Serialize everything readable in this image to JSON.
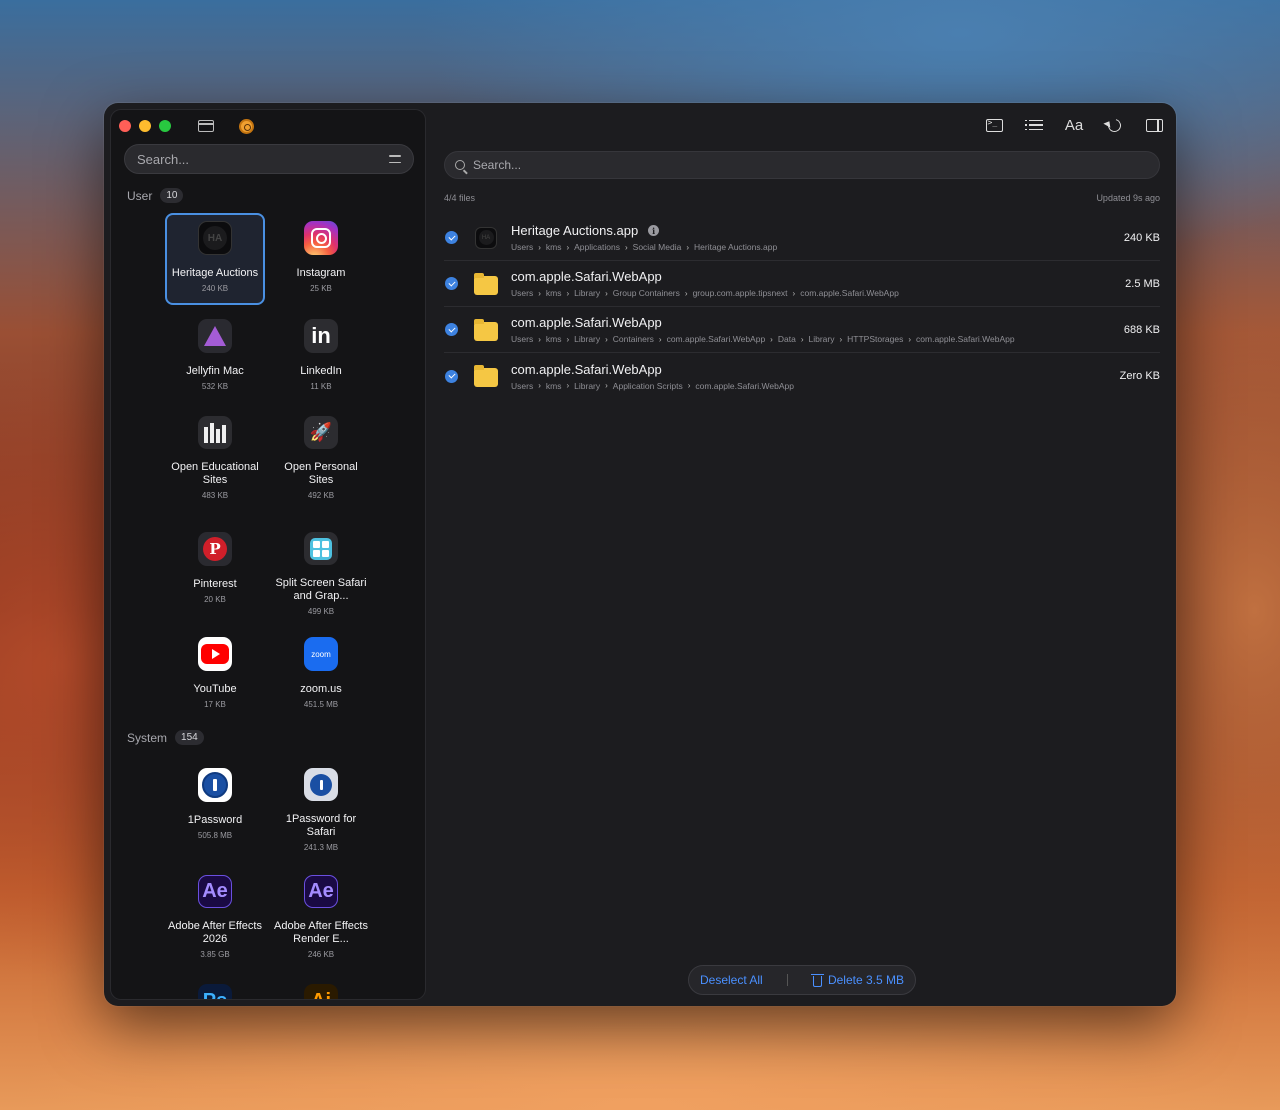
{
  "sidebar": {
    "search_placeholder": "Search...",
    "user_section": {
      "label": "User",
      "count": "10"
    },
    "system_section": {
      "label": "System",
      "count": "154"
    },
    "user_apps": [
      {
        "name": "Heritage Auctions",
        "size": "240 KB",
        "icon": "heritage-auctions-icon",
        "glyph": "HA",
        "selected": true
      },
      {
        "name": "Instagram",
        "size": "25 KB",
        "icon": "instagram-icon"
      },
      {
        "name": "Jellyfin Mac",
        "size": "532 KB",
        "icon": "jellyfin-icon"
      },
      {
        "name": "LinkedIn",
        "size": "11 KB",
        "icon": "linkedin-icon",
        "glyph": "in"
      },
      {
        "name": "Open Educational Sites",
        "size": "483 KB",
        "icon": "library-icon"
      },
      {
        "name": "Open Personal Sites",
        "size": "492 KB",
        "icon": "rocket-icon",
        "glyph": "🚀"
      },
      {
        "name": "Pinterest",
        "size": "20 KB",
        "icon": "pinterest-icon",
        "glyph": "P"
      },
      {
        "name": "Split Screen Safari and Grap...",
        "size": "499 KB",
        "icon": "split-screen-icon"
      },
      {
        "name": "YouTube",
        "size": "17 KB",
        "icon": "youtube-icon"
      },
      {
        "name": "zoom.us",
        "size": "451.5 MB",
        "icon": "zoom-icon",
        "glyph": "zoom"
      }
    ],
    "system_apps": [
      {
        "name": "1Password",
        "size": "505.8 MB",
        "icon": "1password-icon"
      },
      {
        "name": "1Password for Safari",
        "size": "241.3 MB",
        "icon": "1password-safari-icon"
      },
      {
        "name": "Adobe After Effects 2026",
        "size": "3.85 GB",
        "icon": "after-effects-icon",
        "glyph": "Ae"
      },
      {
        "name": "Adobe After Effects Render E...",
        "size": "246 KB",
        "icon": "after-effects-render-icon",
        "glyph": "Ae"
      },
      {
        "name": "",
        "size": "",
        "icon": "photoshop-icon",
        "glyph": "Ps"
      },
      {
        "name": "",
        "size": "",
        "icon": "illustrator-icon",
        "glyph": "Ai"
      }
    ]
  },
  "main": {
    "search_placeholder": "Search...",
    "file_count": "4/4 files",
    "updated": "Updated 9s ago",
    "files": [
      {
        "name": "Heritage Auctions.app",
        "type": "app",
        "glyph": "HA",
        "info": true,
        "size": "240 KB",
        "path": [
          "Users",
          "kms",
          "Applications",
          "Social Media",
          "Heritage Auctions.app"
        ]
      },
      {
        "name": "com.apple.Safari.WebApp",
        "type": "folder",
        "size": "2.5 MB",
        "path": [
          "Users",
          "kms",
          "Library",
          "Group Containers",
          "group.com.apple.tipsnext",
          "com.apple.Safari.WebApp"
        ]
      },
      {
        "name": "com.apple.Safari.WebApp",
        "type": "folder",
        "size": "688 KB",
        "path": [
          "Users",
          "kms",
          "Library",
          "Containers",
          "com.apple.Safari.WebApp",
          "Data",
          "Library",
          "HTTPStorages",
          "com.apple.Safari.WebApp"
        ]
      },
      {
        "name": "com.apple.Safari.WebApp",
        "type": "folder",
        "size": "Zero KB",
        "path": [
          "Users",
          "kms",
          "Library",
          "Application Scripts",
          "com.apple.Safari.WebApp"
        ]
      }
    ],
    "toolbar": {
      "font_label": "Aa"
    },
    "actions": {
      "deselect_label": "Deselect All",
      "delete_label": "Delete 3.5 MB"
    }
  },
  "colors": {
    "accent": "#4a90e2",
    "background": "#1c1c1f",
    "sidebar": "#141416",
    "folder": "#f5c744"
  }
}
